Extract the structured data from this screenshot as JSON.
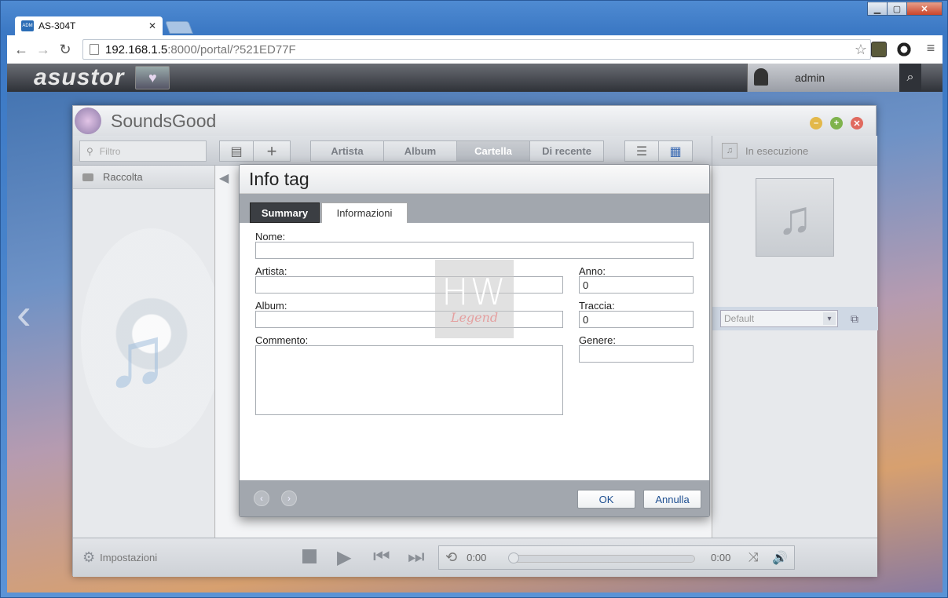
{
  "browser": {
    "tab_title": "AS-304T",
    "tab_favicon": "ADM",
    "url_host": "192.168.1.5",
    "url_rest": ":8000/portal/?521ED77F"
  },
  "adm": {
    "logo": "asustor",
    "user": "admin"
  },
  "app": {
    "name": "SoundsGood",
    "filter_placeholder": "Filtro",
    "tabs": [
      {
        "label": "Artista"
      },
      {
        "label": "Album"
      },
      {
        "label": "Cartella"
      },
      {
        "label": "Di recente"
      }
    ],
    "now_playing_label": "In esecuzione",
    "sidebar": {
      "collection": "Raccolta"
    },
    "settings_label": "Impostazioni",
    "preset": "Default",
    "player": {
      "time_elapsed": "0:00",
      "time_total": "0:00"
    }
  },
  "dialog": {
    "title": "Info tag",
    "tabs": {
      "summary": "Summary",
      "info": "Informazioni"
    },
    "fields": {
      "name_label": "Nome:",
      "name_value": "",
      "artist_label": "Artista:",
      "artist_value": "",
      "year_label": "Anno:",
      "year_value": "0",
      "album_label": "Album:",
      "album_value": "",
      "track_label": "Traccia:",
      "track_value": "0",
      "comment_label": "Commento:",
      "genre_label": "Genere:",
      "genre_value": ""
    },
    "ok": "OK",
    "cancel": "Annulla"
  },
  "watermark": {
    "big": "HW",
    "small": "Legend"
  },
  "colors": {
    "accent": "#1e4f91",
    "chrome_blue": "#3b78c4",
    "close_red": "#c8452c"
  }
}
